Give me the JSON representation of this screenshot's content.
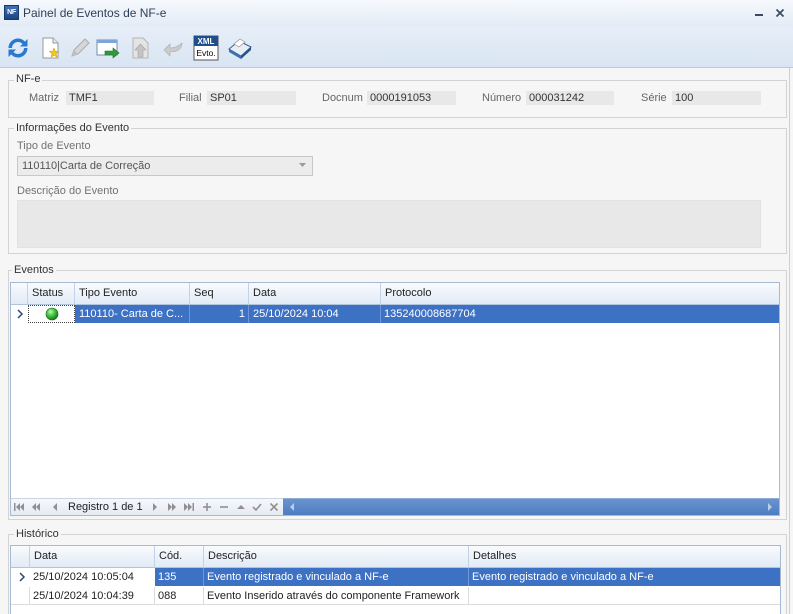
{
  "window": {
    "title": "Painel de Eventos de NF-e",
    "app_icon_text": "NF",
    "controls": [
      "minimize-icon",
      "close-icon"
    ]
  },
  "toolbar": {
    "buttons": [
      {
        "icon": "refresh-icon",
        "enabled": true
      },
      {
        "icon": "new-document-icon",
        "enabled": true
      },
      {
        "icon": "edit-pencil-icon",
        "enabled": false
      },
      {
        "icon": "export-icon",
        "enabled": true
      },
      {
        "icon": "upload-document-icon",
        "enabled": false
      },
      {
        "icon": "undo-arrow-icon",
        "enabled": false
      },
      {
        "icon": "xml-event-icon",
        "enabled": true,
        "label_top": "XML",
        "label_bottom": "Evto."
      },
      {
        "icon": "print-send-icon",
        "enabled": true
      }
    ]
  },
  "nfe": {
    "group_label": "NF-e",
    "matriz_label": "Matriz",
    "matriz_value": "TMF1",
    "filial_label": "Filial",
    "filial_value": "SP01",
    "docnum_label": "Docnum",
    "docnum_value": "0000191053",
    "numero_label": "Número",
    "numero_value": "000031242",
    "serie_label": "Série",
    "serie_value": "100"
  },
  "evento_info": {
    "group_label": "Informações do Evento",
    "tipo_label": "Tipo de Evento",
    "tipo_value": "110110|Carta de Correção",
    "descricao_label": "Descrição do Evento",
    "descricao_value": ""
  },
  "eventos": {
    "group_label": "Eventos",
    "columns": [
      "Status",
      "Tipo Evento",
      "Seq",
      "Data",
      "Protocolo"
    ],
    "rows": [
      {
        "status_icon": "green-ball-icon",
        "tipo": "110110- Carta de C...",
        "seq": "1",
        "data": "25/10/2024 10:04",
        "protocolo": "135240008687704",
        "selected": true
      }
    ],
    "navigator": {
      "record_label": "Registro 1 de 1",
      "buttons": [
        "first-record-icon",
        "prior-page-icon",
        "prior-record-icon",
        "next-record-icon",
        "next-page-icon",
        "last-record-icon",
        "insert-icon",
        "delete-icon",
        "edit-up-icon",
        "post-check-icon",
        "cancel-x-icon"
      ]
    }
  },
  "historico": {
    "group_label": "Histórico",
    "columns": [
      "Data",
      "Cód.",
      "Descrição",
      "Detalhes"
    ],
    "rows": [
      {
        "data": "25/10/2024 10:05:04",
        "cod": "135",
        "descricao": "Evento registrado e vinculado a NF-e",
        "detalhes": "Evento registrado e vinculado a NF-e",
        "selected": true
      },
      {
        "data": "25/10/2024 10:04:39",
        "cod": "088",
        "descricao": "Evento Inserido através do componente Framework",
        "detalhes": "",
        "selected": false
      }
    ]
  },
  "colors": {
    "selection": "#3d71c4",
    "toolbar": "#d9e5f3",
    "field": "#e8e8e8",
    "status_ok": "#22a022",
    "grid_border": "#a7b9d4"
  }
}
